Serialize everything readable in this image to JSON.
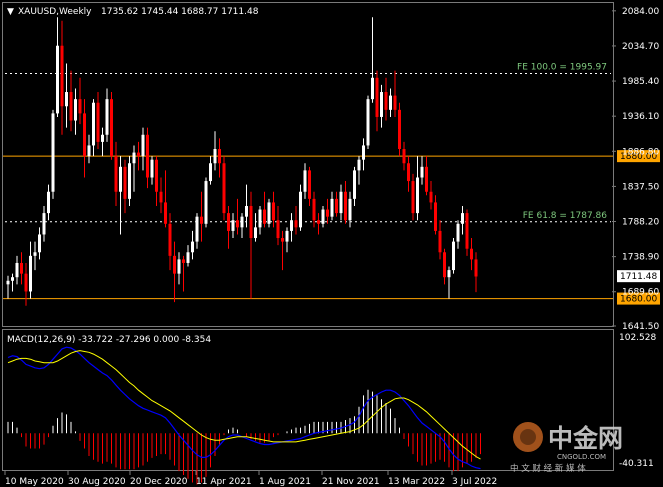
{
  "header": {
    "symbol": "XAUUSD,Weekly",
    "ohlc": "1735.62 1745.44 1688.77 1711.48"
  },
  "colors": {
    "background": "#000000",
    "bull": "#ffffff",
    "bear": "#ff0000",
    "level_line": "#ffa500",
    "fib_line": "#ffffff",
    "fib_label": "#7ec87e",
    "macd_main": "#0000ff",
    "macd_signal": "#ffff00",
    "macd_hist_pos": "#ffffff",
    "macd_hist_neg": "#ff0000"
  },
  "price_axis": {
    "ticks": [
      "2084.00",
      "2034.70",
      "1985.40",
      "1936.10",
      "1886.80",
      "1837.50",
      "1788.20",
      "1738.90",
      "1689.60",
      "1641.50"
    ],
    "current_price": "1711.48"
  },
  "levels": [
    {
      "price": 1880.0,
      "label": "1880.00",
      "style": "solid"
    },
    {
      "price": 1680.0,
      "label": "1680.00",
      "style": "solid"
    }
  ],
  "fib_lines": [
    {
      "price": 1995.97,
      "label": "FE 100.0 = 1995.97"
    },
    {
      "price": 1787.86,
      "label": "FE 61.8 = 1787.86"
    }
  ],
  "indicator": {
    "label": "MACD(12,26,9) -33.722 -27.296 0.000 -8.354",
    "scale_top": "102.528",
    "scale_bottom": "-40.311"
  },
  "time_axis": [
    "10 May 2020",
    "30 Aug 2020",
    "20 Dec 2020",
    "11 Apr 2021",
    "1 Aug 2021",
    "21 Nov 2021",
    "13 Mar 2022",
    "3 Jul 2022"
  ],
  "watermark": {
    "logo_text": "中金网",
    "site": "CNGOLD.COM",
    "tagline": "中 文 财 经 新 媒 体"
  },
  "chart_data": {
    "type": "candlestick",
    "symbol": "XAUUSD",
    "timeframe": "Weekly",
    "ylim": [
      1641.5,
      2095
    ],
    "candles": [
      {
        "o": 1700,
        "h": 1712,
        "l": 1680,
        "c": 1705
      },
      {
        "o": 1705,
        "h": 1715,
        "l": 1690,
        "c": 1710
      },
      {
        "o": 1710,
        "h": 1740,
        "l": 1700,
        "c": 1730
      },
      {
        "o": 1730,
        "h": 1745,
        "l": 1700,
        "c": 1715
      },
      {
        "o": 1715,
        "h": 1730,
        "l": 1670,
        "c": 1690
      },
      {
        "o": 1690,
        "h": 1760,
        "l": 1680,
        "c": 1740
      },
      {
        "o": 1740,
        "h": 1760,
        "l": 1720,
        "c": 1745
      },
      {
        "o": 1745,
        "h": 1780,
        "l": 1735,
        "c": 1770
      },
      {
        "o": 1770,
        "h": 1810,
        "l": 1760,
        "c": 1800
      },
      {
        "o": 1800,
        "h": 1840,
        "l": 1790,
        "c": 1830
      },
      {
        "o": 1830,
        "h": 1945,
        "l": 1820,
        "c": 1940
      },
      {
        "o": 1940,
        "h": 2075,
        "l": 1935,
        "c": 2035
      },
      {
        "o": 2035,
        "h": 2070,
        "l": 1910,
        "c": 1950
      },
      {
        "o": 1950,
        "h": 2010,
        "l": 1920,
        "c": 1970
      },
      {
        "o": 1970,
        "h": 2000,
        "l": 1915,
        "c": 1930
      },
      {
        "o": 1930,
        "h": 1975,
        "l": 1910,
        "c": 1960
      },
      {
        "o": 1960,
        "h": 1990,
        "l": 1925,
        "c": 1940
      },
      {
        "o": 1940,
        "h": 1960,
        "l": 1850,
        "c": 1880
      },
      {
        "o": 1880,
        "h": 1910,
        "l": 1870,
        "c": 1895
      },
      {
        "o": 1895,
        "h": 1960,
        "l": 1880,
        "c": 1955
      },
      {
        "o": 1955,
        "h": 1970,
        "l": 1890,
        "c": 1900
      },
      {
        "o": 1900,
        "h": 1920,
        "l": 1880,
        "c": 1910
      },
      {
        "o": 1910,
        "h": 1975,
        "l": 1900,
        "c": 1960
      },
      {
        "o": 1960,
        "h": 1970,
        "l": 1875,
        "c": 1880
      },
      {
        "o": 1880,
        "h": 1900,
        "l": 1810,
        "c": 1830
      },
      {
        "o": 1830,
        "h": 1880,
        "l": 1770,
        "c": 1865
      },
      {
        "o": 1865,
        "h": 1875,
        "l": 1800,
        "c": 1820
      },
      {
        "o": 1820,
        "h": 1880,
        "l": 1810,
        "c": 1870
      },
      {
        "o": 1870,
        "h": 1895,
        "l": 1830,
        "c": 1885
      },
      {
        "o": 1885,
        "h": 1900,
        "l": 1860,
        "c": 1880
      },
      {
        "o": 1880,
        "h": 1920,
        "l": 1860,
        "c": 1910
      },
      {
        "o": 1910,
        "h": 1920,
        "l": 1835,
        "c": 1850
      },
      {
        "o": 1850,
        "h": 1880,
        "l": 1840,
        "c": 1875
      },
      {
        "o": 1875,
        "h": 1880,
        "l": 1810,
        "c": 1830
      },
      {
        "o": 1830,
        "h": 1850,
        "l": 1800,
        "c": 1815
      },
      {
        "o": 1815,
        "h": 1860,
        "l": 1780,
        "c": 1785
      },
      {
        "o": 1785,
        "h": 1800,
        "l": 1720,
        "c": 1740
      },
      {
        "o": 1740,
        "h": 1760,
        "l": 1675,
        "c": 1715
      },
      {
        "o": 1715,
        "h": 1745,
        "l": 1700,
        "c": 1735
      },
      {
        "o": 1735,
        "h": 1740,
        "l": 1690,
        "c": 1730
      },
      {
        "o": 1730,
        "h": 1755,
        "l": 1725,
        "c": 1745
      },
      {
        "o": 1745,
        "h": 1775,
        "l": 1735,
        "c": 1760
      },
      {
        "o": 1760,
        "h": 1800,
        "l": 1750,
        "c": 1795
      },
      {
        "o": 1795,
        "h": 1830,
        "l": 1760,
        "c": 1785
      },
      {
        "o": 1785,
        "h": 1850,
        "l": 1780,
        "c": 1845
      },
      {
        "o": 1845,
        "h": 1880,
        "l": 1840,
        "c": 1870
      },
      {
        "o": 1870,
        "h": 1915,
        "l": 1860,
        "c": 1890
      },
      {
        "o": 1890,
        "h": 1905,
        "l": 1850,
        "c": 1870
      },
      {
        "o": 1870,
        "h": 1880,
        "l": 1790,
        "c": 1800
      },
      {
        "o": 1800,
        "h": 1810,
        "l": 1750,
        "c": 1775
      },
      {
        "o": 1775,
        "h": 1800,
        "l": 1765,
        "c": 1790
      },
      {
        "o": 1790,
        "h": 1820,
        "l": 1770,
        "c": 1780
      },
      {
        "o": 1780,
        "h": 1800,
        "l": 1765,
        "c": 1795
      },
      {
        "o": 1795,
        "h": 1840,
        "l": 1780,
        "c": 1810
      },
      {
        "o": 1810,
        "h": 1830,
        "l": 1680,
        "c": 1765
      },
      {
        "o": 1765,
        "h": 1800,
        "l": 1760,
        "c": 1780
      },
      {
        "o": 1780,
        "h": 1810,
        "l": 1770,
        "c": 1805
      },
      {
        "o": 1805,
        "h": 1830,
        "l": 1780,
        "c": 1785
      },
      {
        "o": 1785,
        "h": 1820,
        "l": 1780,
        "c": 1815
      },
      {
        "o": 1815,
        "h": 1830,
        "l": 1780,
        "c": 1790
      },
      {
        "o": 1790,
        "h": 1810,
        "l": 1755,
        "c": 1765
      },
      {
        "o": 1765,
        "h": 1775,
        "l": 1720,
        "c": 1760
      },
      {
        "o": 1760,
        "h": 1780,
        "l": 1745,
        "c": 1775
      },
      {
        "o": 1775,
        "h": 1800,
        "l": 1760,
        "c": 1790
      },
      {
        "o": 1790,
        "h": 1810,
        "l": 1770,
        "c": 1780
      },
      {
        "o": 1780,
        "h": 1840,
        "l": 1775,
        "c": 1830
      },
      {
        "o": 1830,
        "h": 1870,
        "l": 1820,
        "c": 1860
      },
      {
        "o": 1860,
        "h": 1865,
        "l": 1810,
        "c": 1820
      },
      {
        "o": 1820,
        "h": 1830,
        "l": 1780,
        "c": 1790
      },
      {
        "o": 1790,
        "h": 1800,
        "l": 1770,
        "c": 1785
      },
      {
        "o": 1785,
        "h": 1810,
        "l": 1780,
        "c": 1805
      },
      {
        "o": 1805,
        "h": 1820,
        "l": 1785,
        "c": 1795
      },
      {
        "o": 1795,
        "h": 1830,
        "l": 1790,
        "c": 1820
      },
      {
        "o": 1820,
        "h": 1830,
        "l": 1795,
        "c": 1800
      },
      {
        "o": 1800,
        "h": 1840,
        "l": 1790,
        "c": 1830
      },
      {
        "o": 1830,
        "h": 1845,
        "l": 1785,
        "c": 1790
      },
      {
        "o": 1790,
        "h": 1830,
        "l": 1780,
        "c": 1820
      },
      {
        "o": 1820,
        "h": 1865,
        "l": 1810,
        "c": 1860
      },
      {
        "o": 1860,
        "h": 1880,
        "l": 1840,
        "c": 1875
      },
      {
        "o": 1875,
        "h": 1905,
        "l": 1860,
        "c": 1895
      },
      {
        "o": 1895,
        "h": 1965,
        "l": 1890,
        "c": 1960
      },
      {
        "o": 1960,
        "h": 2075,
        "l": 1955,
        "c": 1990
      },
      {
        "o": 1990,
        "h": 2000,
        "l": 1915,
        "c": 1935
      },
      {
        "o": 1935,
        "h": 1980,
        "l": 1920,
        "c": 1970
      },
      {
        "o": 1970,
        "h": 1990,
        "l": 1930,
        "c": 1945
      },
      {
        "o": 1945,
        "h": 1975,
        "l": 1935,
        "c": 1965
      },
      {
        "o": 1965,
        "h": 2000,
        "l": 1935,
        "c": 1945
      },
      {
        "o": 1945,
        "h": 1955,
        "l": 1880,
        "c": 1890
      },
      {
        "o": 1890,
        "h": 1900,
        "l": 1860,
        "c": 1870
      },
      {
        "o": 1870,
        "h": 1880,
        "l": 1830,
        "c": 1845
      },
      {
        "o": 1845,
        "h": 1855,
        "l": 1790,
        "c": 1800
      },
      {
        "o": 1800,
        "h": 1880,
        "l": 1790,
        "c": 1850
      },
      {
        "o": 1850,
        "h": 1880,
        "l": 1840,
        "c": 1865
      },
      {
        "o": 1865,
        "h": 1880,
        "l": 1825,
        "c": 1830
      },
      {
        "o": 1830,
        "h": 1845,
        "l": 1805,
        "c": 1815
      },
      {
        "o": 1815,
        "h": 1825,
        "l": 1770,
        "c": 1775
      },
      {
        "o": 1775,
        "h": 1790,
        "l": 1735,
        "c": 1745
      },
      {
        "o": 1745,
        "h": 1750,
        "l": 1700,
        "c": 1710
      },
      {
        "o": 1710,
        "h": 1725,
        "l": 1680,
        "c": 1720
      },
      {
        "o": 1720,
        "h": 1765,
        "l": 1715,
        "c": 1760
      },
      {
        "o": 1760,
        "h": 1790,
        "l": 1750,
        "c": 1785
      },
      {
        "o": 1785,
        "h": 1810,
        "l": 1770,
        "c": 1800
      },
      {
        "o": 1800,
        "h": 1805,
        "l": 1740,
        "c": 1750
      },
      {
        "o": 1750,
        "h": 1765,
        "l": 1720,
        "c": 1735
      },
      {
        "o": 1735,
        "h": 1745,
        "l": 1689,
        "c": 1711
      }
    ],
    "levels": [
      1880.0,
      1680.0
    ],
    "fib_levels": [
      1995.97,
      1787.86
    ],
    "macd": {
      "label": "MACD(12,26,9)",
      "ylim": [
        -40.311,
        102.528
      ],
      "main": [
        88,
        90,
        89,
        85,
        80,
        78,
        76,
        75,
        76,
        80,
        86,
        92,
        98,
        100,
        99,
        96,
        92,
        87,
        82,
        78,
        74,
        70,
        67,
        62,
        56,
        50,
        45,
        40,
        36,
        32,
        29,
        27,
        25,
        23,
        21,
        18,
        12,
        5,
        -2,
        -8,
        -14,
        -20,
        -25,
        -28,
        -28,
        -25,
        -20,
        -14,
        -8,
        -4,
        -2,
        -2,
        -4,
        -6,
        -8,
        -10,
        -12,
        -13,
        -13,
        -12,
        -11,
        -10,
        -9,
        -8,
        -7,
        -6,
        -4,
        -2,
        0,
        1,
        2,
        3,
        4,
        5,
        6,
        8,
        10,
        13,
        20,
        30,
        38,
        42,
        45,
        48,
        50,
        50,
        48,
        44,
        38,
        32,
        25,
        18,
        12,
        8,
        4,
        0,
        -4,
        -10,
        -18,
        -25,
        -30,
        -33,
        -35,
        -38,
        -40,
        -41
      ],
      "signal": [
        82,
        84,
        86,
        87,
        87,
        86,
        84,
        83,
        82,
        82,
        82,
        84,
        87,
        90,
        93,
        95,
        96,
        95,
        94,
        92,
        89,
        86,
        82,
        78,
        74,
        69,
        64,
        59,
        55,
        50,
        46,
        42,
        38,
        35,
        32,
        29,
        26,
        22,
        18,
        14,
        10,
        6,
        2,
        -2,
        -5,
        -7,
        -8,
        -8,
        -7,
        -6,
        -5,
        -4,
        -4,
        -4,
        -5,
        -6,
        -7,
        -8,
        -9,
        -10,
        -10,
        -10,
        -10,
        -10,
        -10,
        -9,
        -8,
        -7,
        -6,
        -5,
        -4,
        -3,
        -2,
        -1,
        0,
        1,
        2,
        4,
        6,
        10,
        15,
        20,
        25,
        30,
        34,
        37,
        40,
        41,
        41,
        39,
        36,
        33,
        29,
        25,
        20,
        15,
        10,
        5,
        0,
        -5,
        -10,
        -15,
        -19,
        -23,
        -27,
        -30
      ]
    }
  }
}
